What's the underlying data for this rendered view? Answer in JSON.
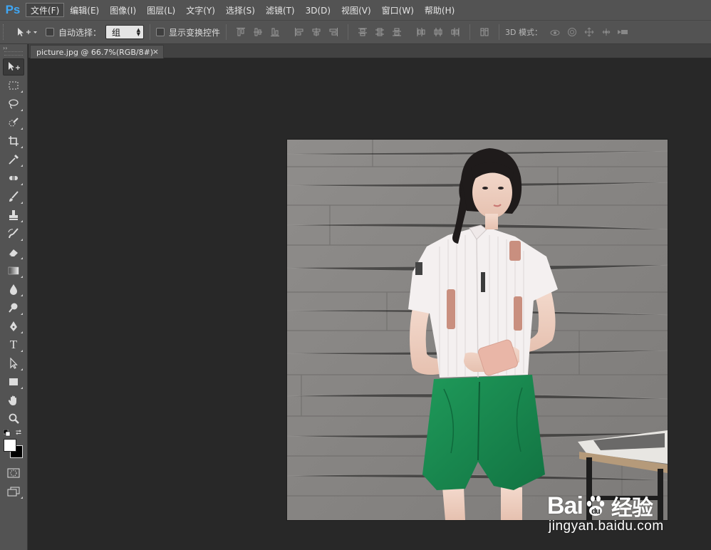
{
  "app": {
    "logo": "Ps"
  },
  "menu": [
    {
      "label": "文件(F)",
      "active": true
    },
    {
      "label": "编辑(E)"
    },
    {
      "label": "图像(I)"
    },
    {
      "label": "图层(L)"
    },
    {
      "label": "文字(Y)"
    },
    {
      "label": "选择(S)"
    },
    {
      "label": "滤镜(T)"
    },
    {
      "label": "3D(D)"
    },
    {
      "label": "视图(V)"
    },
    {
      "label": "窗口(W)"
    },
    {
      "label": "帮助(H)"
    }
  ],
  "options": {
    "auto_select_label": "自动选择：",
    "auto_select_checked": false,
    "auto_select_value": "组",
    "show_transform_label": "显示变换控件",
    "show_transform_checked": false,
    "mode3d_label": "3D 模式："
  },
  "document": {
    "tab_title": "picture.jpg @ 66.7%(RGB/8#)",
    "close_glyph": "×"
  },
  "tools": {
    "type_tool_glyph": "T",
    "foreground_color": "#ffffff",
    "background_color": "#000000"
  },
  "watermark": {
    "brand_a": "Bai",
    "brand_b": "du",
    "brand_c": "经验",
    "url": "jingyan.baidu.com"
  }
}
